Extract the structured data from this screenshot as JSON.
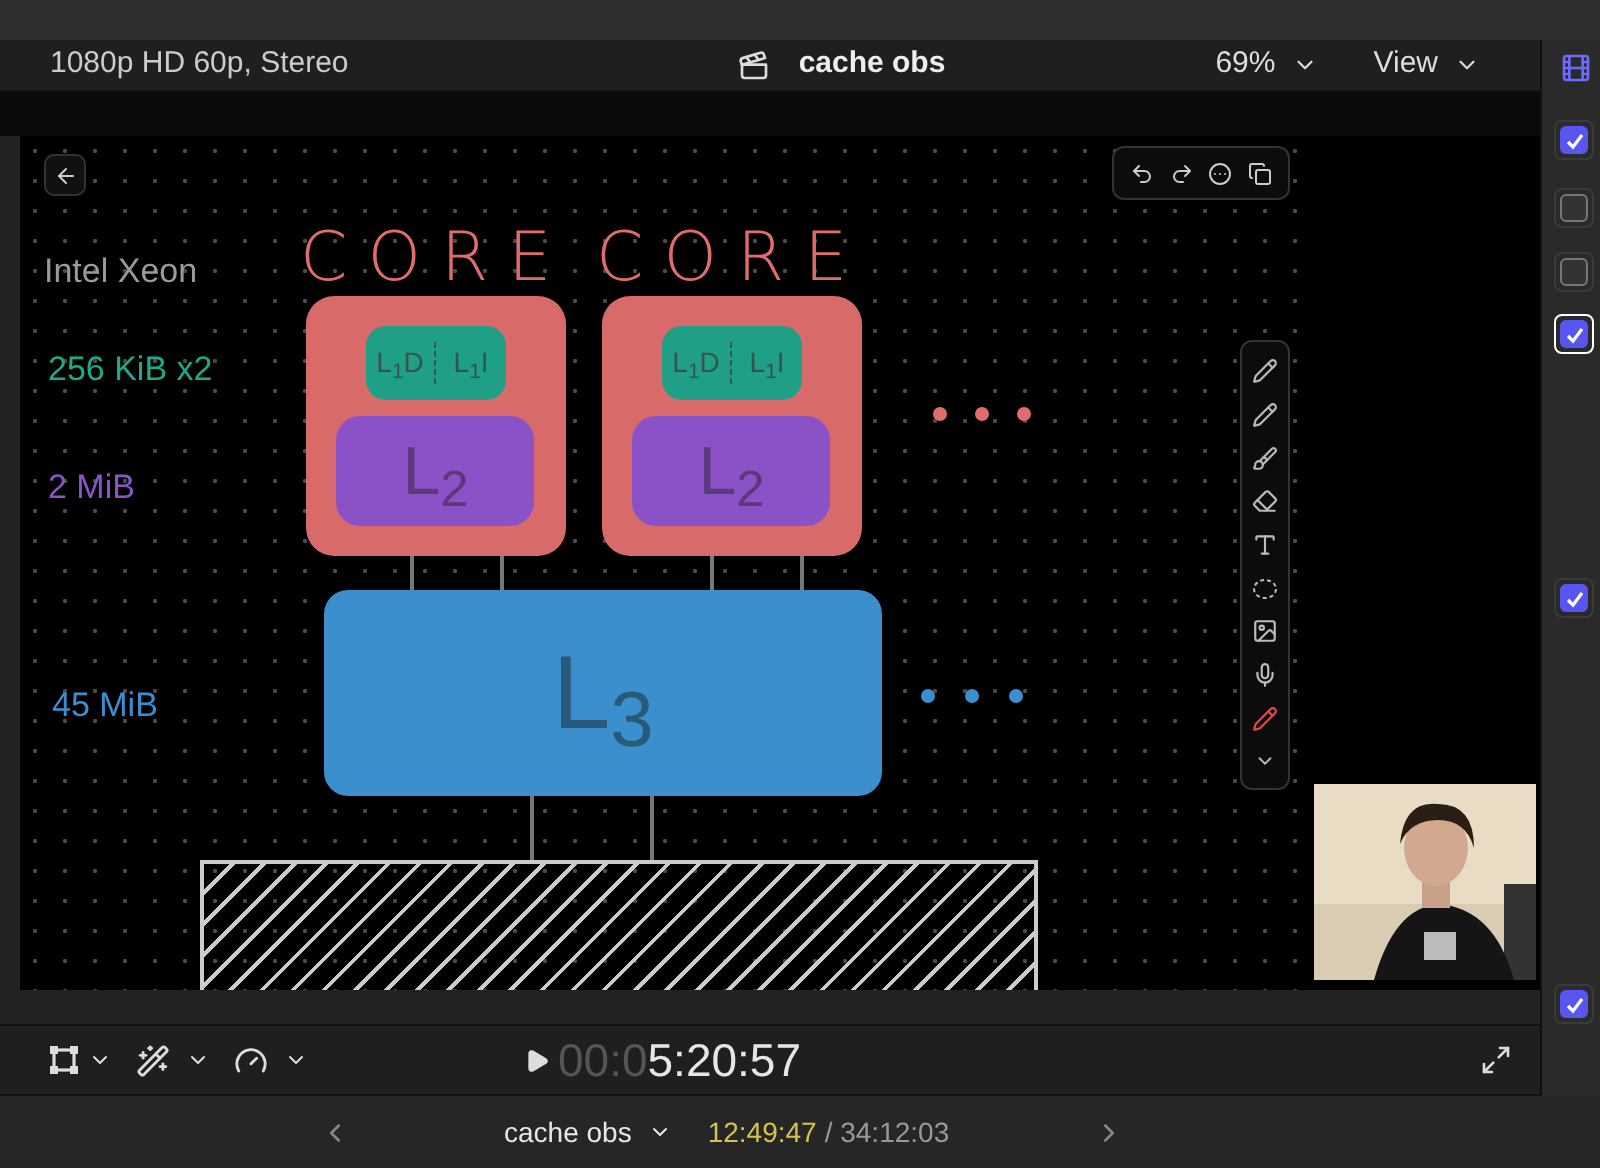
{
  "header": {
    "format": "1080p HD 60p, Stereo",
    "project": "cache obs",
    "zoom": "69%",
    "view": "View"
  },
  "canvas": {
    "labels": [
      {
        "text": "Intel Xeon",
        "color": "#9a9a9a"
      },
      {
        "text": "256 KiB x2",
        "color": "#1fa889"
      },
      {
        "text": "2 MiB",
        "color": "#8b55c9"
      },
      {
        "text": "45 MiB",
        "color": "#3a8fd0"
      }
    ],
    "cores": [
      {
        "title": "CORE",
        "l1d": "L$_{1}$D",
        "l1i": "L$_{1}$I",
        "l2": "L$_{2}$"
      },
      {
        "title": "CORE",
        "l1d": "L$_{1}$D",
        "l1i": "L$_{1}$I",
        "l2": "L$_{2}$"
      }
    ],
    "l3": "L$_{3}$"
  },
  "right_panel": {
    "checkboxes": [
      {
        "checked": true,
        "focused": false
      },
      {
        "checked": false,
        "focused": false
      },
      {
        "checked": false,
        "focused": false
      },
      {
        "checked": true,
        "focused": true
      },
      {
        "checked": true,
        "focused": false
      },
      {
        "checked": true,
        "focused": false
      }
    ]
  },
  "playback": {
    "timecode_dim": "00:0",
    "timecode": "5:20:57"
  },
  "timeline": {
    "clip": "cache obs",
    "position": "12:49:47",
    "duration": "/ 34:12:03"
  }
}
